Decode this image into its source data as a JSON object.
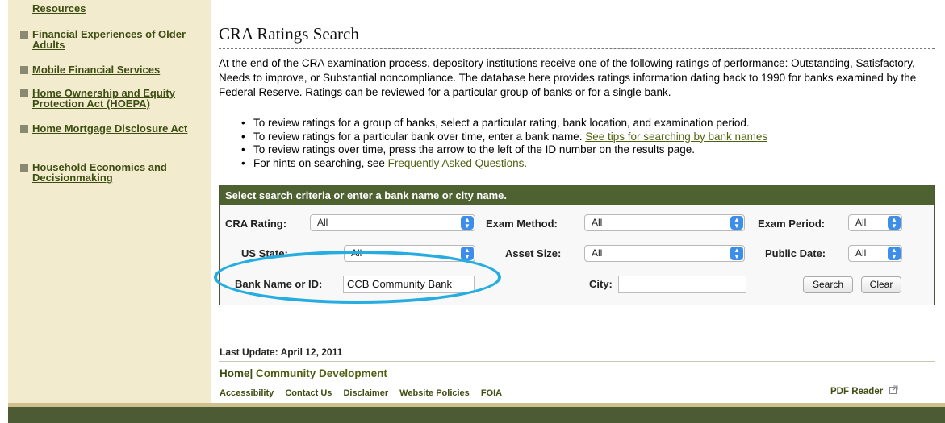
{
  "sidebar": {
    "items": [
      {
        "label": "Resources",
        "bullet": false
      },
      {
        "label": "Financial Experiences of Older Adults",
        "bullet": true
      },
      {
        "label": "Mobile Financial Services",
        "bullet": true
      },
      {
        "label": "Home Ownership and Equity Protection Act (HOEPA)",
        "bullet": true
      },
      {
        "label": "Home Mortgage Disclosure Act",
        "bullet": true
      },
      {
        "label": "Household Economics and Decisionmaking",
        "bullet": true
      }
    ]
  },
  "main": {
    "title": "CRA Ratings Search",
    "intro": "At the end of the CRA examination process, depository institutions receive one of the following ratings of performance: Outstanding, Satisfactory, Needs to improve, or Substantial noncompliance. The database here provides ratings information dating back to 1990 for banks examined by the Federal Reserve. Ratings can be reviewed for a particular group of banks or for a single bank.",
    "bullets": {
      "b1": "To review ratings for a group of banks, select a particular rating, bank location, and examination period.",
      "b2_text": "To review ratings for a particular bank over time, enter a bank name. ",
      "b2_link": "See tips for searching by bank names",
      "b3": "To review ratings over time, press the arrow to the left of the ID number on the results page.",
      "b4_text": "For hints on searching, see ",
      "b4_link": "Frequently Asked Questions."
    }
  },
  "search": {
    "header": "Select search criteria or enter a bank name or city name.",
    "cra_rating_label": "CRA Rating:",
    "cra_rating_value": "All",
    "exam_method_label": "Exam Method:",
    "exam_method_value": "All",
    "exam_period_label": "Exam Period:",
    "exam_period_value": "All",
    "us_state_label": "US State:",
    "us_state_value": "All",
    "asset_size_label": "Asset Size:",
    "asset_size_value": "All",
    "public_date_label": "Public Date:",
    "public_date_value": "All",
    "bank_name_label": "Bank Name or ID:",
    "bank_name_value": "CCB Community Bank",
    "city_label": "City:",
    "city_value": "",
    "search_button": "Search",
    "clear_button": "Clear"
  },
  "footer": {
    "last_update": "Last Update: April 12, 2011",
    "home": "Home|",
    "community": " Community Development",
    "links": [
      "Accessibility",
      "Contact Us",
      "Disclaimer",
      "Website Policies",
      "FOIA"
    ],
    "pdf_reader": "PDF Reader"
  },
  "colors": {
    "sidebar_bg": "#f3ebce",
    "header_green": "#4e6130",
    "link_green": "#4e6110",
    "highlight_oval": "#25ade1",
    "select_arrow_blue": "#3d8ee8"
  },
  "icons": {
    "select_arrow": "updown-chevron-icon",
    "external_link": "external-link-icon",
    "bullet": "square-bullet-icon"
  }
}
